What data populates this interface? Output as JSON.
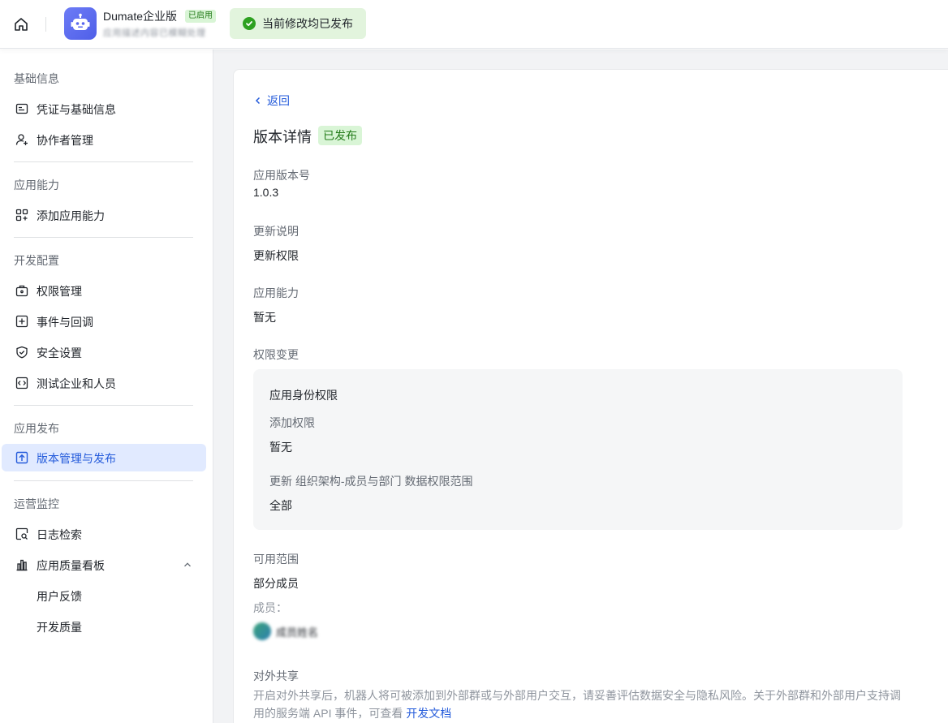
{
  "header": {
    "app_name": "Dumate企业版",
    "app_status": "已启用",
    "app_subtitle": "应用描述内容已模糊处理",
    "toast": "当前修改均已发布"
  },
  "sidebar": {
    "groups": [
      {
        "title": "基础信息",
        "items": [
          "凭证与基础信息",
          "协作者管理"
        ]
      },
      {
        "title": "应用能力",
        "items": [
          "添加应用能力"
        ]
      },
      {
        "title": "开发配置",
        "items": [
          "权限管理",
          "事件与回调",
          "安全设置",
          "测试企业和人员"
        ]
      },
      {
        "title": "应用发布",
        "items": [
          "版本管理与发布"
        ]
      },
      {
        "title": "运营监控",
        "items": [
          "日志检索",
          "应用质量看板",
          "用户反馈",
          "开发质量"
        ]
      }
    ],
    "active_item": "版本管理与发布"
  },
  "main": {
    "back": "返回",
    "title": "版本详情",
    "status": "已发布",
    "version_label": "应用版本号",
    "version_value": "1.0.3",
    "notes_label": "更新说明",
    "notes_value": "更新权限",
    "capability_label": "应用能力",
    "capability_value": "暂无",
    "perm_label": "权限变更",
    "perm_box": {
      "title": "应用身份权限",
      "add_label": "添加权限",
      "add_value": "暂无",
      "update_label": "更新 组织架构-成员与部门 数据权限范围",
      "update_value": "全部"
    },
    "scope_label": "可用范围",
    "scope_value": "部分成员",
    "members_label": "成员：",
    "member_name": "成员姓名",
    "share_label": "对外共享",
    "share_desc": "开启对外共享后，机器人将可被添加到外部群或与外部用户交互，请妥善评估数据安全与隐私风险。关于外部群和外部用户支持调用的服务端 API 事件，可查看 ",
    "share_link": "开发文档"
  },
  "colors": {
    "accent": "#245bdb",
    "active_bg": "#e1eaff",
    "success_bg": "#d9f5d6",
    "success_text": "#237b19"
  }
}
